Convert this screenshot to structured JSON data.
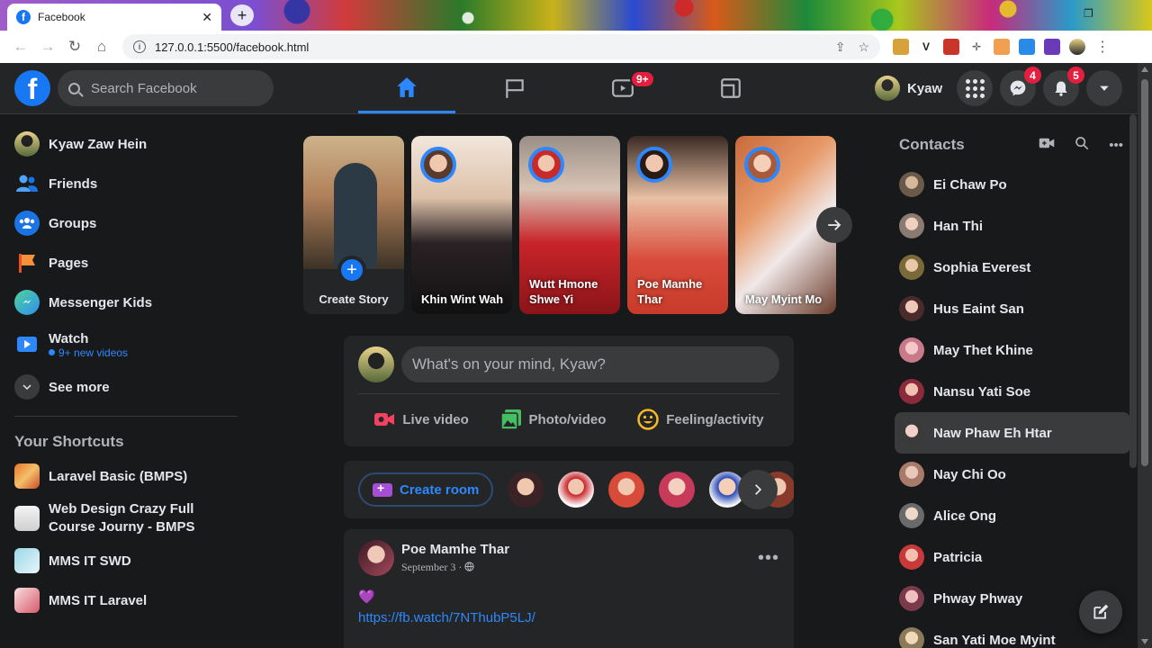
{
  "browser": {
    "tab_title": "Facebook",
    "tab_close": "✕",
    "new_tab": "+",
    "url": "127.0.0.1:5500/facebook.html"
  },
  "header": {
    "logo": "f",
    "search_placeholder": "Search Facebook",
    "watch_badge": "9+",
    "profile_name": "Kyaw",
    "messenger_badge": "4",
    "notifications_badge": "5"
  },
  "sidebar": {
    "items": [
      {
        "label": "Kyaw Zaw Hein",
        "icon": "profile-avatar"
      },
      {
        "label": "Friends",
        "icon": "friends-icon"
      },
      {
        "label": "Groups",
        "icon": "groups-icon"
      },
      {
        "label": "Pages",
        "icon": "pages-flag-icon"
      },
      {
        "label": "Messenger Kids",
        "icon": "messenger-kids-icon"
      },
      {
        "label": "Watch",
        "icon": "watch-icon",
        "sub": "9+ new videos"
      },
      {
        "label": "See more",
        "icon": "chevron-down-icon"
      }
    ],
    "shortcuts_title": "Your Shortcuts",
    "shortcuts": [
      {
        "label": "Laravel Basic (BMPS)"
      },
      {
        "label": "Web Design Crazy Full Course Journy - BMPS"
      },
      {
        "label": "MMS IT SWD"
      },
      {
        "label": "MMS IT Laravel"
      }
    ]
  },
  "stories": {
    "create_label": "Create Story",
    "items": [
      {
        "name": "Khin Wint Wah"
      },
      {
        "name": "Wutt Hmone Shwe Yi"
      },
      {
        "name": "Poe Mamhe Thar"
      },
      {
        "name": "May Myint Mo"
      }
    ]
  },
  "composer": {
    "placeholder": "What's on your mind, Kyaw?",
    "actions": [
      {
        "label": "Live video",
        "color": "#f3425f"
      },
      {
        "label": "Photo/video",
        "color": "#45bd62"
      },
      {
        "label": "Feeling/activity",
        "color": "#f7b928"
      }
    ]
  },
  "rooms": {
    "create_label": "Create room"
  },
  "post": {
    "author": "Poe Mamhe Thar",
    "date": "September 3 · ",
    "emoji": "💜",
    "link": "https://fb.watch/7NThubP5LJ/",
    "more": "•••"
  },
  "contacts": {
    "title": "Contacts",
    "list": [
      "Ei Chaw Po",
      "Han Thi",
      "Sophia Everest",
      "Hus Eaint San",
      "May Thet Khine",
      "Nansu Yati Soe",
      "Naw Phaw Eh Htar",
      "Nay Chi Oo",
      "Alice Ong",
      "Patricia",
      "Phway Phway",
      "San Yati Moe Myint"
    ]
  },
  "colors": {
    "accent": "#2d88ff",
    "brand": "#1877f2",
    "badge": "#e41e3f",
    "background": "#18191a",
    "surface": "#242526"
  }
}
